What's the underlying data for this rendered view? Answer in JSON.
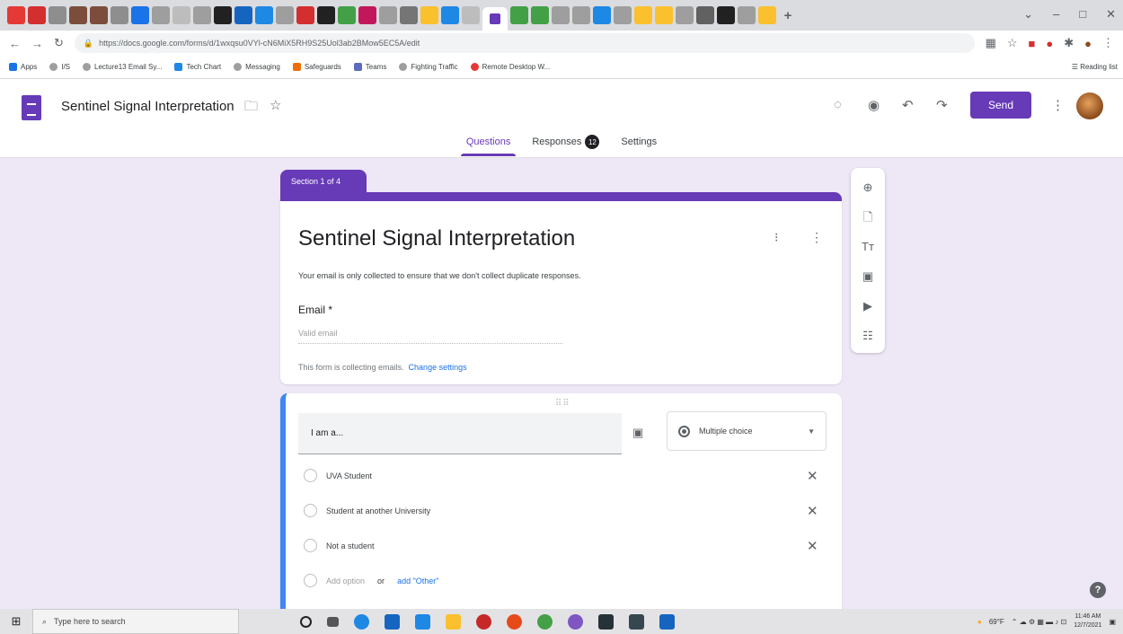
{
  "browser": {
    "url": "https://docs.google.com/forms/d/1wxqsu0VYl-cN6MiX5RH9S25Uol3ab2BMow5EC5A/edit",
    "bookmarks": [
      "Apps",
      "I/S",
      "Lecture13 Email Sy...",
      "Tech Chart",
      "Messaging",
      "Safeguards",
      "Teams",
      "Fighting Traffic",
      "Remote Desktop W..."
    ],
    "reading_list": "Reading list",
    "colors": {
      "tabstrip": "#dadce0"
    }
  },
  "header": {
    "doc_title": "Sentinel Signal Interpretation",
    "send_label": "Send",
    "tabs": [
      {
        "label": "Questions",
        "active": true
      },
      {
        "label": "Responses",
        "badge": "12"
      },
      {
        "label": "Settings"
      }
    ]
  },
  "section": {
    "label": "Section 1 of 4"
  },
  "form": {
    "title": "Sentinel Signal Interpretation",
    "description": "Your email is only collected to ensure that we don't collect duplicate responses.",
    "email_label": "Email *",
    "email_placeholder": "Valid email",
    "collect_note": "This form is collecting emails.",
    "change_settings": "Change settings"
  },
  "question": {
    "title": "I am a...",
    "type": "Multiple choice",
    "options": [
      "UVA Student",
      "Student at another University",
      "Not a student"
    ],
    "add_option": "Add option",
    "or": "or",
    "add_other": "add \"Other\""
  },
  "taskbar": {
    "search_placeholder": "Type here to search",
    "weather": "69°F",
    "time": "11:46 AM",
    "date": "12/7/2021"
  },
  "accent_color": "#673ab7"
}
